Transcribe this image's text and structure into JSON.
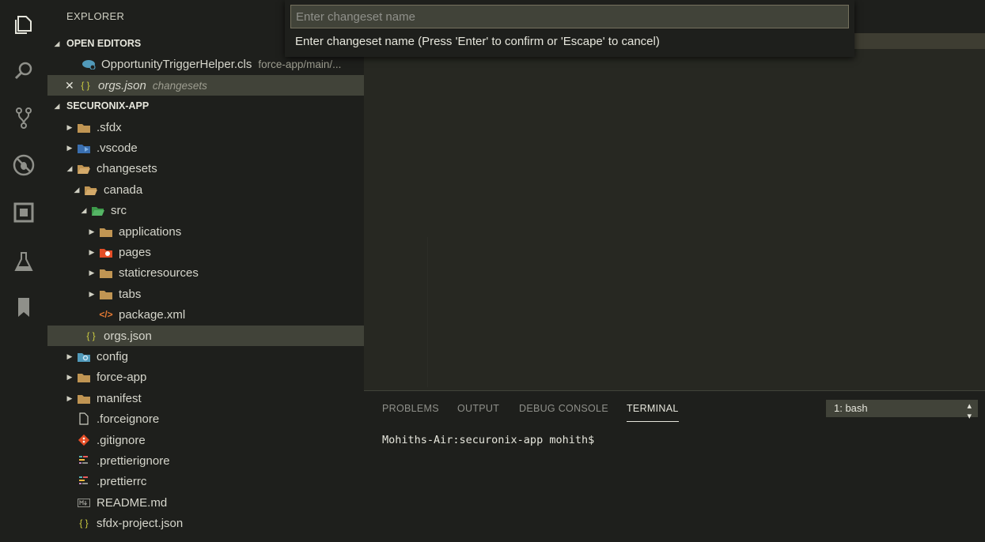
{
  "colors": {
    "activity_bg": "#1e1f1c",
    "editor_bg": "#272822",
    "selection": "#414339",
    "folder": "#c09553",
    "json_brace": "#cbcb41",
    "xml": "#e37933",
    "salesforce": "#519aba"
  },
  "activity_bar": {
    "items": [
      {
        "icon": "files-icon"
      },
      {
        "icon": "search-icon"
      },
      {
        "icon": "source-control-icon"
      },
      {
        "icon": "debug-icon"
      },
      {
        "icon": "extensions-icon"
      },
      {
        "icon": "test-flask-icon"
      },
      {
        "icon": "bookmark-icon"
      }
    ]
  },
  "sidebar": {
    "title": "EXPLORER",
    "open_editors": {
      "heading": "OPEN EDITORS",
      "items": [
        {
          "name": "OpportunityTriggerHelper.cls",
          "desc": "force-app/main/..."
        },
        {
          "name": "orgs.json",
          "desc": "changesets"
        }
      ]
    },
    "project": {
      "heading": "SECURONIX-APP",
      "tree": [
        {
          "label": ".sfdx"
        },
        {
          "label": ".vscode"
        },
        {
          "label": "changesets"
        },
        {
          "label": "canada"
        },
        {
          "label": "src"
        },
        {
          "label": "applications"
        },
        {
          "label": "pages"
        },
        {
          "label": "staticresources"
        },
        {
          "label": "tabs"
        },
        {
          "label": "package.xml"
        },
        {
          "label": "orgs.json"
        },
        {
          "label": "config"
        },
        {
          "label": "force-app"
        },
        {
          "label": "manifest"
        },
        {
          "label": ".forceignore"
        },
        {
          "label": ".gitignore"
        },
        {
          "label": ".prettierignore"
        },
        {
          "label": ".prettierrc"
        },
        {
          "label": "README.md"
        },
        {
          "label": "sfdx-project.json"
        }
      ]
    }
  },
  "quick_input": {
    "placeholder": "Enter changeset name",
    "value": "",
    "message": "Enter changeset name (Press 'Enter' to confirm or 'Escape' to cancel)"
  },
  "panel": {
    "tabs": [
      "PROBLEMS",
      "OUTPUT",
      "DEBUG CONSOLE",
      "TERMINAL"
    ],
    "active_tab": "TERMINAL",
    "terminal_select": "1: bash",
    "terminal_prompt": "Mohiths-Air:securonix-app mohith$"
  }
}
